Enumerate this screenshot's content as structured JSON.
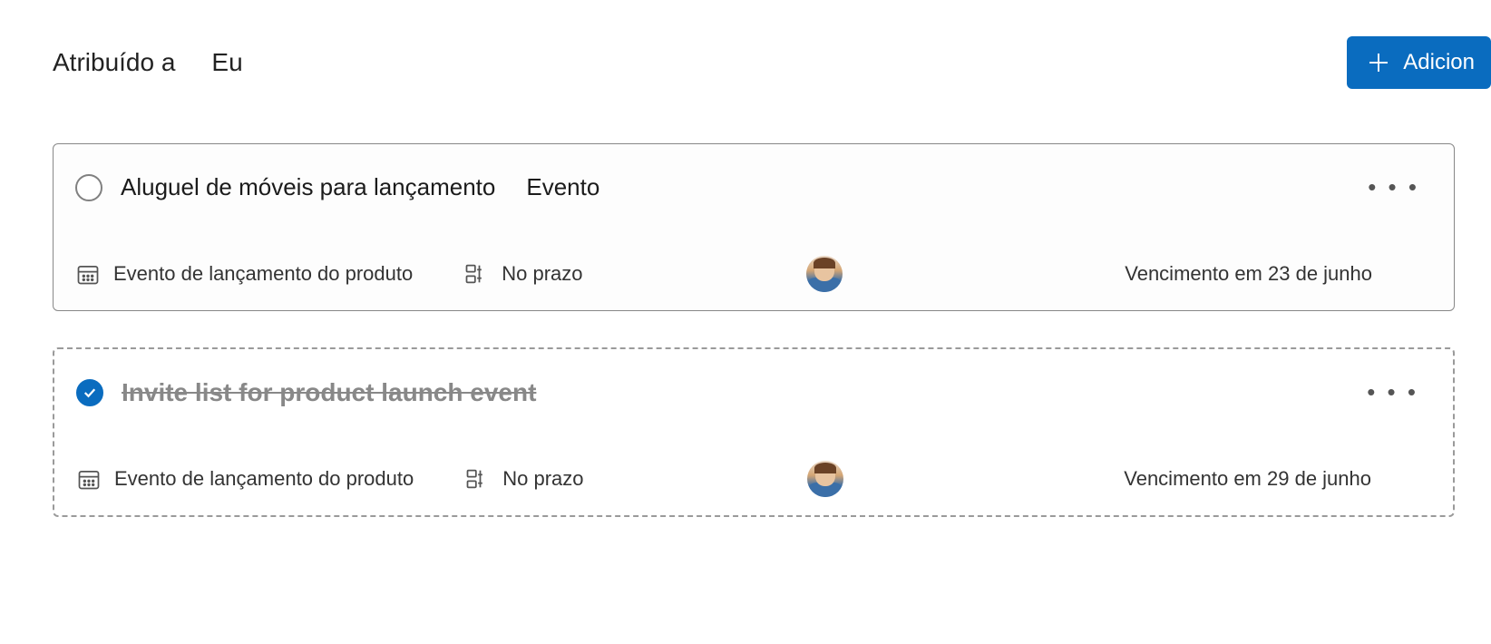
{
  "header": {
    "title": "Atribuído a",
    "filter": "Eu",
    "add_button": "Adicion"
  },
  "tasks": [
    {
      "title": "Aluguel de móveis para lançamento",
      "tag": "Evento",
      "completed": false,
      "project": "Evento de lançamento do produto",
      "status": "No prazo",
      "due_date": "Vencimento em 23 de junho"
    },
    {
      "title": "Invite list for product launch event",
      "tag": "",
      "completed": true,
      "project": "Evento de lançamento do produto",
      "status": "No prazo",
      "due_date": "Vencimento em 29 de junho"
    }
  ]
}
